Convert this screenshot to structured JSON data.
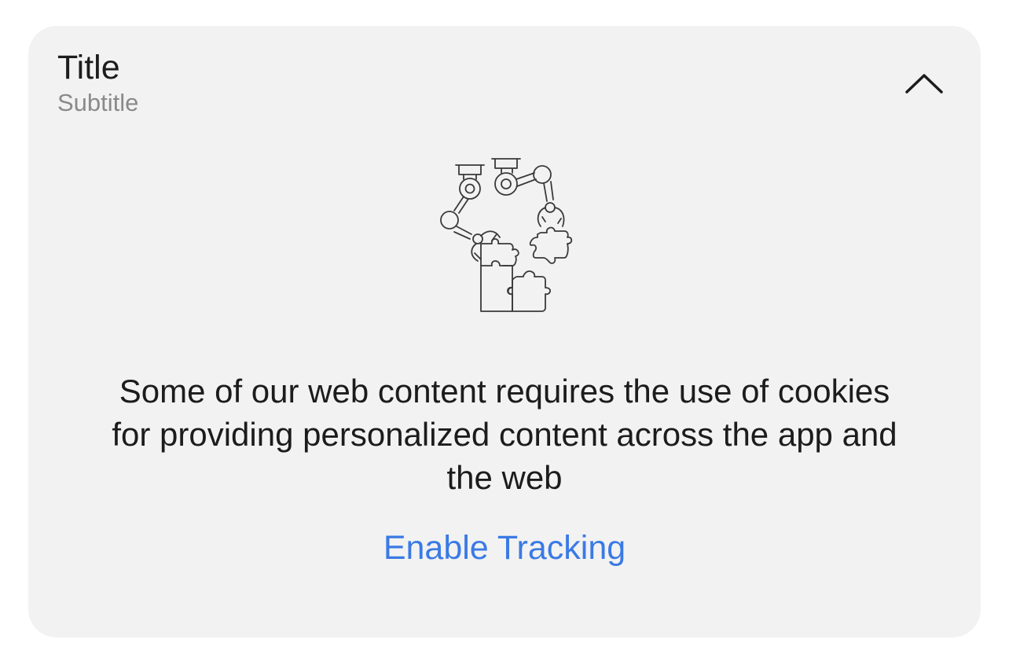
{
  "card": {
    "title": "Title",
    "subtitle": "Subtitle",
    "collapse_icon": "chevron-up-icon",
    "illustration_icon": "robot-arms-puzzle-icon",
    "message": "Some of our web content requires the use of cookies for providing personalized content across the app and the web",
    "action_label": "Enable Tracking"
  },
  "colors": {
    "card_background": "#f2f2f2",
    "text_primary": "#1c1c1c",
    "text_secondary": "#8a8a8a",
    "accent": "#3a7ae4"
  }
}
